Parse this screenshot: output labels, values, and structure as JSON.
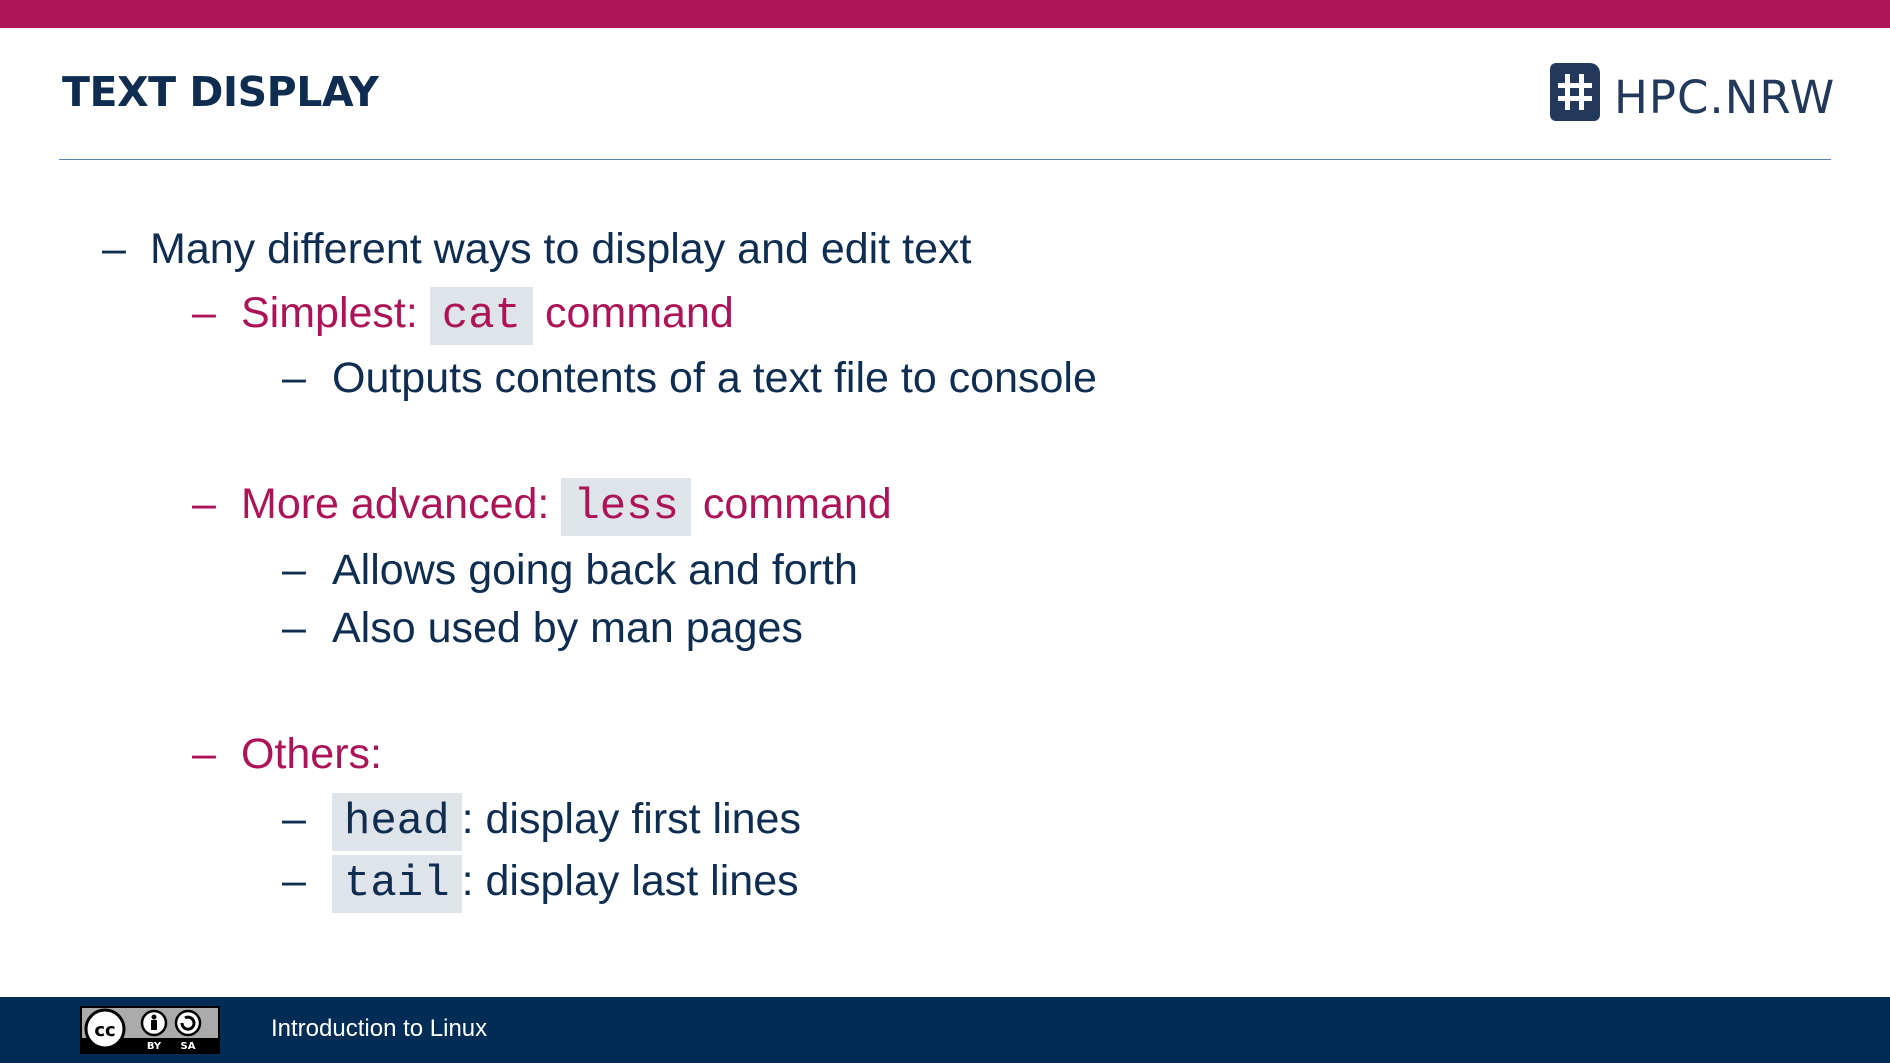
{
  "slide": {
    "title": "TEXT DISPLAY"
  },
  "logo": {
    "text": "HPC.NRW",
    "icon": "hpc-hash-icon"
  },
  "bullets": {
    "dash": "–",
    "b1": "Many different ways to display and edit text",
    "b2_prefix": "Simplest:",
    "b2_code": "cat",
    "b2_suffix": "command",
    "b3": "Outputs contents of a text file to console",
    "b4_prefix": "More advanced:",
    "b4_code": "less",
    "b4_suffix": "command",
    "b5": "Allows going back and forth",
    "b6": "Also used by man pages",
    "b7": "Others:",
    "b8_code": "head",
    "b8_suffix": ": display first lines",
    "b9_code": "tail",
    "b9_suffix": ": display last lines"
  },
  "footer": {
    "text": "Introduction to Linux",
    "license_label_by": "BY",
    "license_label_sa": "SA",
    "license_icon": "cc-by-sa-icon"
  },
  "colors": {
    "accent": "#ad1457",
    "navy": "#0e2d50",
    "footer": "#002c55"
  }
}
